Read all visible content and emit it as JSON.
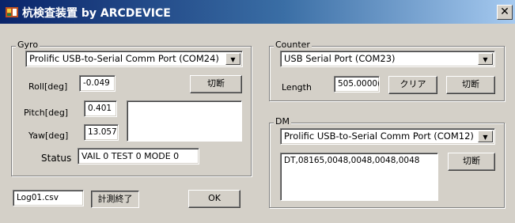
{
  "window": {
    "title": "杭検査装置 by ARCDEVICE",
    "close_glyph": "✕"
  },
  "gyro": {
    "legend": "Gyro",
    "port": "Prolific USB-to-Serial Comm Port (COM24)",
    "roll_label": "Roll[deg]",
    "roll_value": "-0.049",
    "pitch_label": "Pitch[deg]",
    "pitch_value": "0.401",
    "yaw_label": "Yaw[deg]",
    "yaw_value": "13.057",
    "disconnect_label": "切断",
    "memo": "",
    "status_label": "Status",
    "status_value": "VAIL 0 TEST 0 MODE 0"
  },
  "counter": {
    "legend": "Counter",
    "port": "USB Serial Port (COM23)",
    "length_label": "Length",
    "length_value": "505.0000(",
    "clear_label": "クリア",
    "disconnect_label": "切断"
  },
  "dm": {
    "legend": "DM",
    "port": "Prolific USB-to-Serial Comm Port (COM12)",
    "memo": "DT,08165,0048,0048,0048,0048",
    "disconnect_label": "切断"
  },
  "footer": {
    "log_file": "Log01.csv",
    "measure_end_label": "計測終了",
    "ok_label": "OK"
  },
  "icons": {
    "app": "app-icon",
    "dropdown": "▼"
  }
}
